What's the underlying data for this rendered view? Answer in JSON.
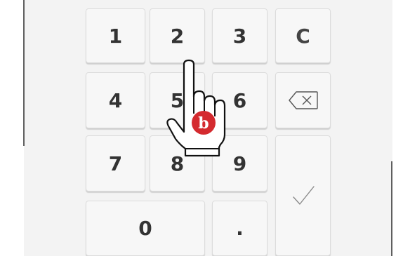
{
  "keypad": {
    "keys": {
      "one": "1",
      "two": "2",
      "three": "3",
      "clear": "C",
      "four": "4",
      "five": "5",
      "six": "6",
      "seven": "7",
      "eight": "8",
      "nine": "9",
      "zero": "0",
      "dot": "."
    },
    "icons": {
      "backspace": "backspace-icon",
      "enter": "checkmark-icon"
    }
  },
  "cursor": {
    "type": "hand-pointer",
    "badge_letter": "b",
    "badge_color": "#d42a2f"
  },
  "colors": {
    "key_bg": "#f7f7f7",
    "panel_bg": "#f3f3f3",
    "text": "#333333"
  }
}
